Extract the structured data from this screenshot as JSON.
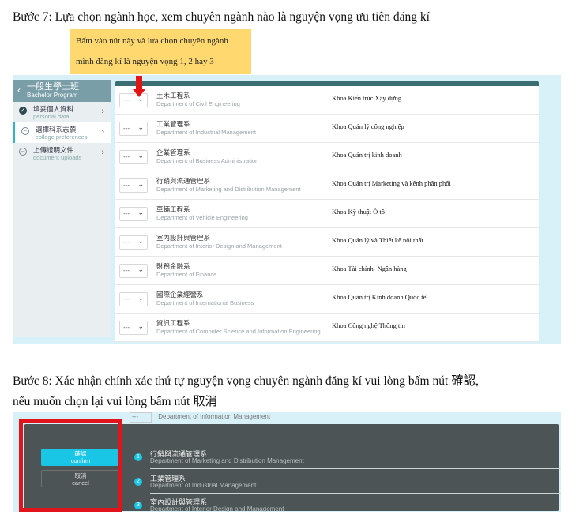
{
  "step7": "Bước 7: Lựa chọn ngành học, xem chuyên ngành nào là nguyện vọng ưu tiên đăng kí",
  "note": {
    "line1": "Bấm vào nút này và lựa chọn chuyên ngành",
    "line2": "mình đăng kí là nguyện vọng 1, 2 hay 3"
  },
  "sidebar": {
    "back_icon": "chevron-left-icon",
    "title": "一般生學士班",
    "subtitle": "Bachelor Program",
    "items": [
      {
        "zh": "填妥個人資料",
        "en": "personal data",
        "status": "done"
      },
      {
        "zh": "選擇科系志願",
        "en": "college preferences",
        "status": "pending"
      },
      {
        "zh": "上傳證明文件",
        "en": "document uploads",
        "status": "pending"
      }
    ]
  },
  "select_default": "---",
  "departments": [
    {
      "zh": "土木工程系",
      "en": "Department of Civil Engineering",
      "faculty": "Khoa Kiến trúc Xây dựng"
    },
    {
      "zh": "工業管理系",
      "en": "Department of Industrial Management",
      "faculty": "Khoa Quản lý công nghiệp"
    },
    {
      "zh": "企業管理系",
      "en": "Department of Business Administration",
      "faculty": "Khoa Quản trị kinh doanh"
    },
    {
      "zh": "行銷與流通管理系",
      "en": "Department of Marketing and Distribution Management",
      "faculty": "Khoa Quản trị Marketing và kênh phân phối"
    },
    {
      "zh": "車輛工程系",
      "en": "Department of Vehicle Engineering",
      "faculty": "Khoa Kỹ thuật Ô tô"
    },
    {
      "zh": "室內設計與管理系",
      "en": "Department of Interior Design and Management",
      "faculty": "Khoa Quản lý và Thiết kế nội thất"
    },
    {
      "zh": "財務金融系",
      "en": "Department of Finance",
      "faculty": "Khoa Tài chính- Ngân hàng"
    },
    {
      "zh": "國際企業經營系",
      "en": "Department of International Business",
      "faculty": "Khoa Quản trị Kinh doanh Quốc tế"
    },
    {
      "zh": "資訊工程系",
      "en": "Department of Computer Science and Information Engineering",
      "faculty": "Khoa Công nghệ Thông tin"
    }
  ],
  "step8": {
    "line1": "Bước 8: Xác nhận chính xác thứ tự nguyện vọng chuyên ngành đăng kí vui lòng bấm nút 確認,",
    "line2": "nếu muốn chọn lại vui lòng bấm nút 取消"
  },
  "confirm_dialog": {
    "background_row": {
      "select": "---",
      "text": "Department of Information Management"
    },
    "confirm": {
      "zh": "確認",
      "en": "confirm"
    },
    "cancel": {
      "zh": "取消",
      "en": "cancel"
    },
    "ordered": [
      {
        "num": "1",
        "zh": "行銷與流通管理系",
        "en": "Department of Marketing and Distribution Management"
      },
      {
        "num": "2",
        "zh": "工業管理系",
        "en": "Department of Industrial Management"
      },
      {
        "num": "3",
        "zh": "室內設計與管理系",
        "en": "Department of Interior Design and Management"
      }
    ]
  },
  "colors": {
    "accent": "#19c6e6",
    "highlight_red": "#e0141a",
    "note_bg": "#ffd970",
    "dialog_bg": "#4d5456"
  }
}
